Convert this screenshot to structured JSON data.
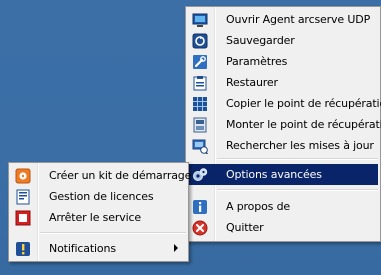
{
  "main_menu": {
    "items": [
      {
        "label": "Ouvrir Agent arcserve UDP",
        "icon": "monitor-icon"
      },
      {
        "label": "Sauvegarder",
        "icon": "backup-icon"
      },
      {
        "label": "Paramètres",
        "icon": "wrench-icon"
      },
      {
        "label": "Restaurer",
        "icon": "clipboard-restore-icon"
      },
      {
        "label": "Copier le point de récupération",
        "icon": "grid-copy-icon"
      },
      {
        "label": "Monter le point de récupération",
        "icon": "mount-icon"
      },
      {
        "label": "Rechercher les mises à jour",
        "icon": "update-icon"
      },
      {
        "label": "Options avancées",
        "icon": "gears-icon",
        "selected": true
      },
      {
        "label": "A propos de",
        "icon": "info-icon"
      },
      {
        "label": "Quitter",
        "icon": "exit-icon"
      }
    ]
  },
  "submenu": {
    "items": [
      {
        "label": "Créer un kit de démarrage",
        "icon": "boot-kit-icon"
      },
      {
        "label": "Gestion de licences",
        "icon": "license-icon"
      },
      {
        "label": "Arrêter le service",
        "icon": "stop-service-icon"
      },
      {
        "label": "Notifications",
        "icon": "notification-icon",
        "has_submenu": true
      }
    ]
  },
  "colors": {
    "desktop": "#3a6ea5",
    "menu_bg": "#f0f0f0",
    "highlight": "#0a246a"
  }
}
